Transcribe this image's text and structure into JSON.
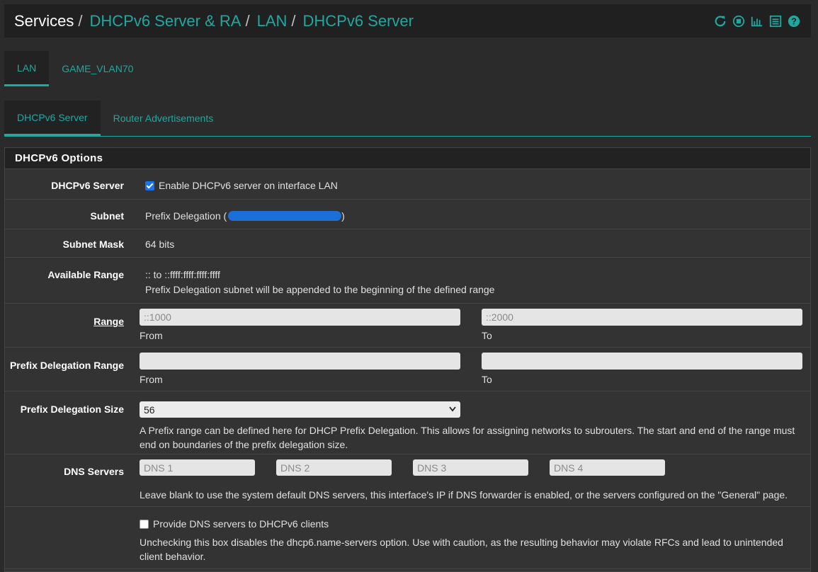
{
  "breadcrumb": {
    "items": [
      {
        "label": "Services",
        "link": false
      },
      {
        "label": "DHCPv6 Server & RA",
        "link": true
      },
      {
        "label": "LAN",
        "link": true
      },
      {
        "label": "DHCPv6 Server",
        "link": true
      }
    ],
    "separator": "/"
  },
  "header_icons": [
    "reload-icon",
    "stop-icon",
    "chart-icon",
    "list-icon",
    "help-icon"
  ],
  "interface_tabs": [
    {
      "label": "LAN",
      "active": true
    },
    {
      "label": "GAME_VLAN70",
      "active": false
    }
  ],
  "sub_tabs": [
    {
      "label": "DHCPv6 Server",
      "active": true
    },
    {
      "label": "Router Advertisements",
      "active": false
    }
  ],
  "panel": {
    "title": "DHCPv6 Options",
    "dhcpv6_server": {
      "label": "DHCPv6 Server",
      "checkbox_label": "Enable DHCPv6 server on interface LAN",
      "checked": true
    },
    "subnet": {
      "label": "Subnet",
      "value": "Prefix Delegation (",
      "value_end": ")"
    },
    "subnet_mask": {
      "label": "Subnet Mask",
      "value": "64 bits"
    },
    "available_range": {
      "label": "Available Range",
      "value": ":: to ::ffff:ffff:ffff:ffff",
      "help": "Prefix Delegation subnet will be appended to the beginning of the defined range"
    },
    "range": {
      "label": "Range",
      "from_value": "::1000",
      "to_value": "::2000",
      "from_label": "From",
      "to_label": "To"
    },
    "pd_range": {
      "label": "Prefix Delegation Range",
      "from_value": "",
      "to_value": "",
      "from_label": "From",
      "to_label": "To"
    },
    "pd_size": {
      "label": "Prefix Delegation Size",
      "selected": "56",
      "help": "A Prefix range can be defined here for DHCP Prefix Delegation. This allows for assigning networks to subrouters. The start and end of the range must end on boundaries of the prefix delegation size."
    },
    "dns_servers": {
      "label": "DNS Servers",
      "placeholders": [
        "DNS 1",
        "DNS 2",
        "DNS 3",
        "DNS 4"
      ],
      "help": "Leave blank to use the system default DNS servers, this interface's IP if DNS forwarder is enabled, or the servers configured on the \"General\" page."
    },
    "provide_dns": {
      "checkbox_label": "Provide DNS servers to DHCPv6 clients",
      "checked": false,
      "help": "Unchecking this box disables the dhcp6.name-servers option. Use with caution, as the resulting behavior may violate RFCs and lead to unintended client behavior."
    }
  },
  "colors": {
    "accent": "#1ea8a0",
    "background": "#2b2b2b",
    "panel": "#333333",
    "header": "#202020",
    "checkbox": "#1a73e8"
  }
}
